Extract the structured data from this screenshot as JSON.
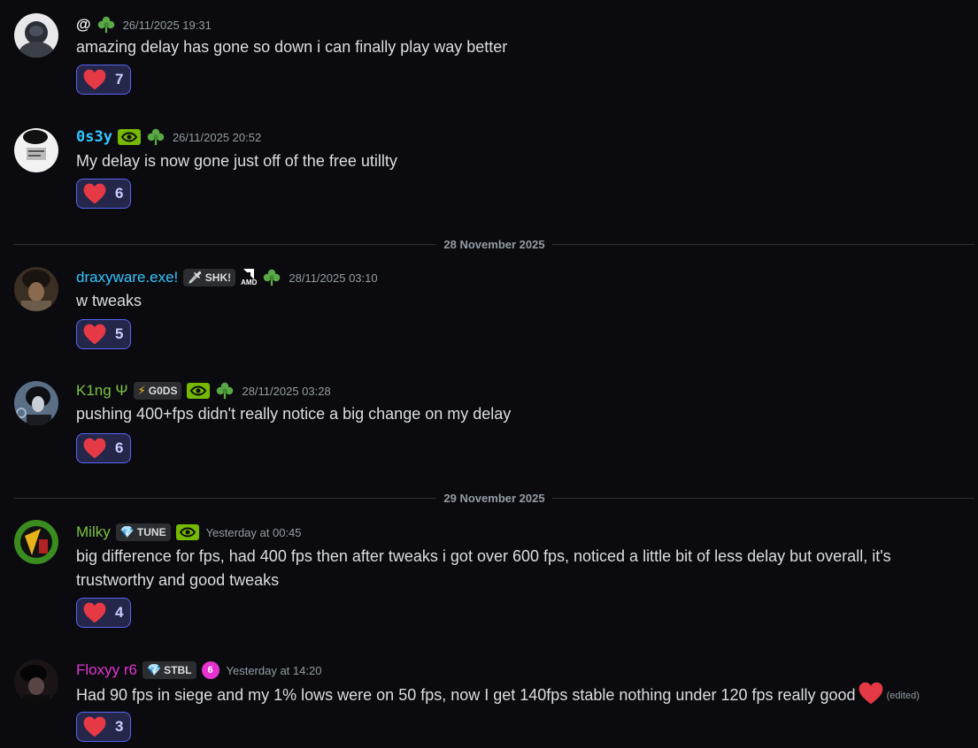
{
  "dividers": {
    "d1": "28 November 2025",
    "d2": "29 November 2025"
  },
  "messages": [
    {
      "username": "@",
      "timestamp": "26/11/2025 19:31",
      "content": "amazing delay has gone so down i can finally play way better",
      "reaction_count": "7"
    },
    {
      "username": "0s3y",
      "timestamp": "26/11/2025 20:52",
      "content": "My delay is now gone just off of the free utillty",
      "reaction_count": "6"
    },
    {
      "username": "draxyware.exe!",
      "tag": "SHK!",
      "amd_label": "AMD",
      "timestamp": "28/11/2025 03:10",
      "content": "w tweaks",
      "reaction_count": "5"
    },
    {
      "username": "K1ng Ψ",
      "tag": "G0DS",
      "timestamp": "28/11/2025 03:28",
      "content": "pushing 400+fps didn't really notice a big change on my delay",
      "reaction_count": "6"
    },
    {
      "username": "Milky",
      "tag": "TUNE",
      "timestamp": "Yesterday at 00:45",
      "content": "big difference for fps, had 400 fps then after tweaks i got over 600 fps, noticed a little bit of less delay but overall, it's trustworthy and good tweaks",
      "reaction_count": "4"
    },
    {
      "username": "Floxyy r6",
      "tag": "STBL",
      "level_badge": "6",
      "timestamp": "Yesterday at 14:20",
      "content": "Had 90 fps in siege and my 1% lows were on 50 fps, now I get 140fps stable nothing under 120 fps really good",
      "edited_label": "(edited)",
      "reaction_count": "3"
    }
  ],
  "colors": {
    "background": "#0b0b0f",
    "username_default": "#ffffff",
    "username_cyan": "#33c6ff",
    "username_green": "#7cc242",
    "username_magenta": "#e633d0",
    "reaction_border": "#5865f2",
    "reaction_bg": "#24264a",
    "heart": "#e63946"
  }
}
